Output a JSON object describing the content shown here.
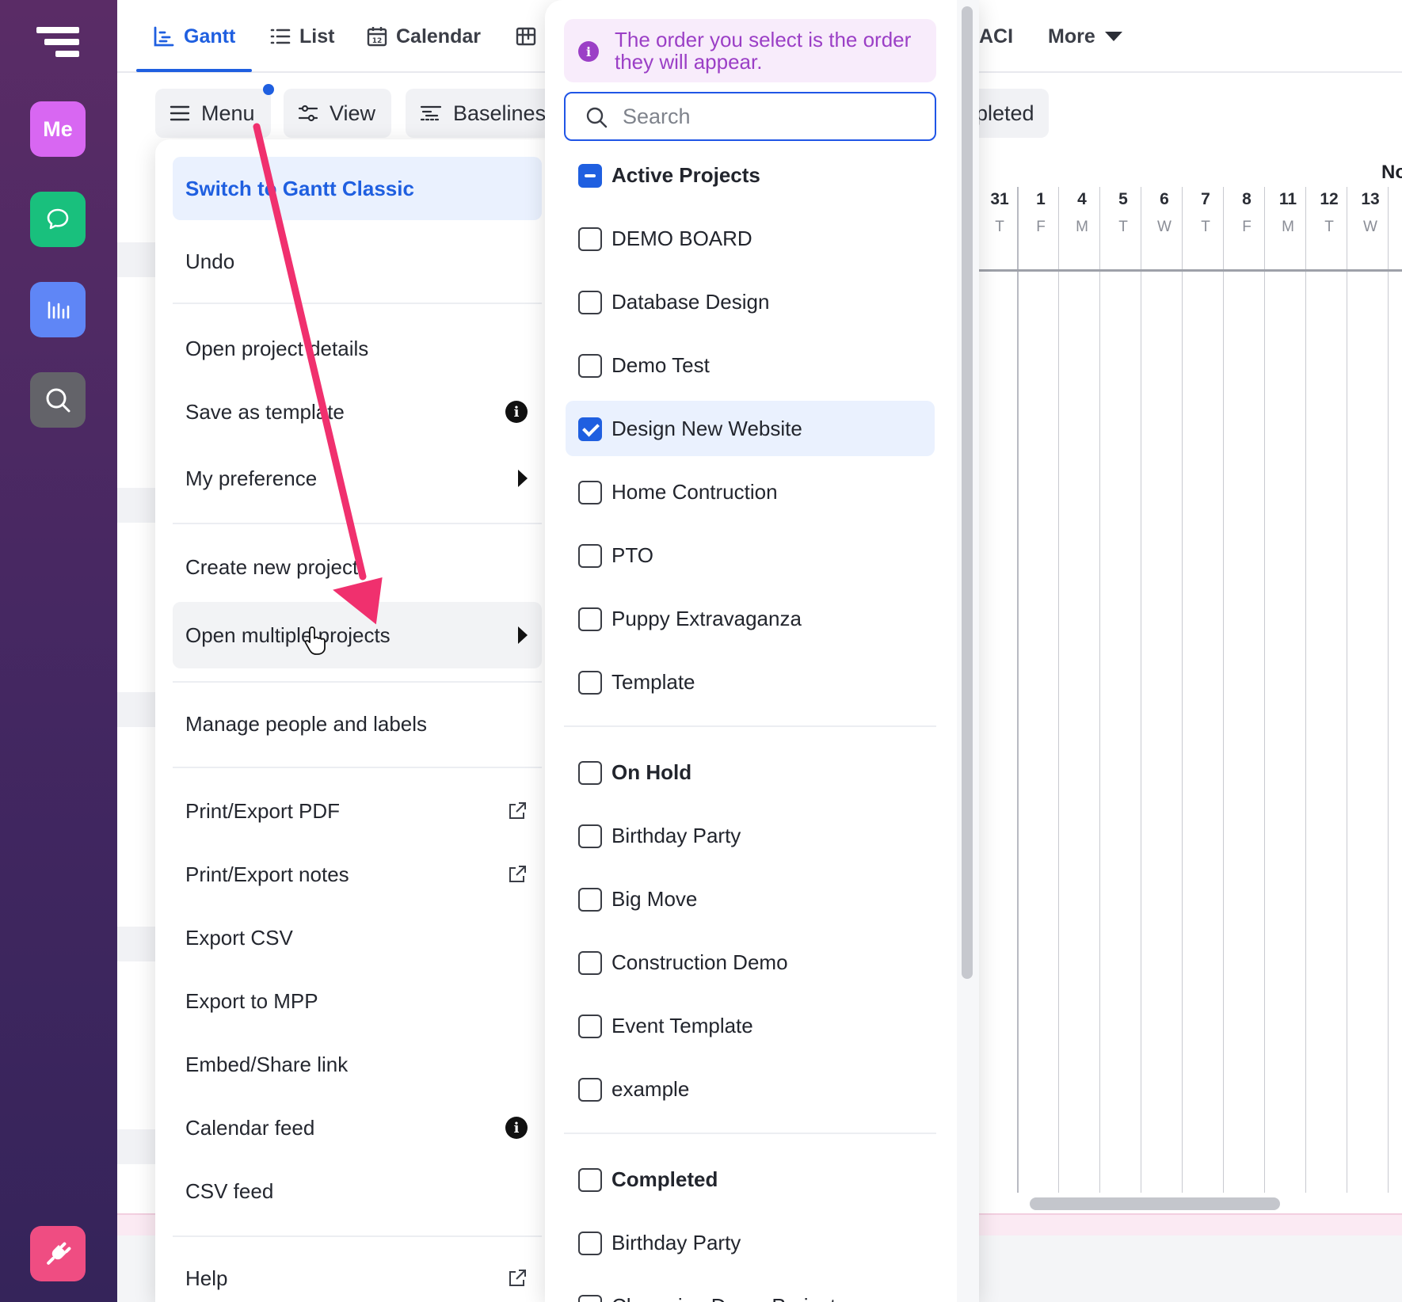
{
  "rail": {
    "me_label": "Me",
    "icons": [
      "app-logo-icon",
      "chat-icon",
      "reports-icon",
      "search-icon",
      "integrations-icon"
    ]
  },
  "nav": {
    "tabs": [
      {
        "label": "Gantt",
        "icon": "gantt-icon",
        "active": true
      },
      {
        "label": "List",
        "icon": "list-icon"
      },
      {
        "label": "Calendar",
        "icon": "calendar-icon"
      },
      {
        "label": "",
        "icon": "board-icon"
      }
    ],
    "raci_partial": "ACI",
    "more_label": "More"
  },
  "toolbar": {
    "menu_label": "Menu",
    "view_label": "View",
    "baselines_label": "Baselines",
    "completed_partial": "pleted"
  },
  "menu": {
    "switch_classic": "Switch to Gantt Classic",
    "undo": "Undo",
    "open_project_details": "Open project details",
    "save_as_template": "Save as template",
    "my_preferences": "My preference",
    "create_new_project": "Create new project",
    "open_multiple_projects": "Open multiple projects",
    "manage_people_labels": "Manage people and labels",
    "print_export_pdf": "Print/Export PDF",
    "print_export_notes": "Print/Export notes",
    "export_csv": "Export CSV",
    "export_mpp": "Export to MPP",
    "embed_share": "Embed/Share link",
    "calendar_feed": "Calendar feed",
    "csv_feed": "CSV feed",
    "help": "Help"
  },
  "picker": {
    "notice": "The order you select is the order they will appear.",
    "search_placeholder": "Search",
    "groups": [
      {
        "heading": "Active Projects",
        "state": "partial",
        "items": [
          {
            "label": "DEMO BOARD",
            "checked": false
          },
          {
            "label": "Database Design",
            "checked": false
          },
          {
            "label": "Demo Test",
            "checked": false
          },
          {
            "label": "Design New Website",
            "checked": true
          },
          {
            "label": "Home Contruction",
            "checked": false
          },
          {
            "label": "PTO",
            "checked": false
          },
          {
            "label": "Puppy Extravaganza",
            "checked": false
          },
          {
            "label": "Template",
            "checked": false
          }
        ]
      },
      {
        "heading": "On Hold",
        "state": "unchecked",
        "items": [
          {
            "label": "Birthday Party",
            "checked": false
          },
          {
            "label": "Big Move",
            "checked": false
          },
          {
            "label": "Construction Demo",
            "checked": false
          },
          {
            "label": "Event Template",
            "checked": false
          },
          {
            "label": "example",
            "checked": false
          }
        ]
      },
      {
        "heading": "Completed",
        "state": "unchecked",
        "items": [
          {
            "label": "Birthday Party",
            "checked": false
          },
          {
            "label": "Champion Demo Project",
            "checked": false
          }
        ]
      }
    ]
  },
  "timeline": {
    "month_partial": "No",
    "days": [
      {
        "d": "31",
        "w": "T"
      },
      {
        "d": "1",
        "w": "F"
      },
      {
        "d": "4",
        "w": "M"
      },
      {
        "d": "5",
        "w": "T"
      },
      {
        "d": "6",
        "w": "W"
      },
      {
        "d": "7",
        "w": "T"
      },
      {
        "d": "8",
        "w": "F"
      },
      {
        "d": "11",
        "w": "M"
      },
      {
        "d": "12",
        "w": "T"
      },
      {
        "d": "13",
        "w": "W"
      }
    ]
  },
  "colors": {
    "accent": "#1f5fe0",
    "notice_text": "#9b3fc6",
    "arrow": "#f0306e"
  }
}
